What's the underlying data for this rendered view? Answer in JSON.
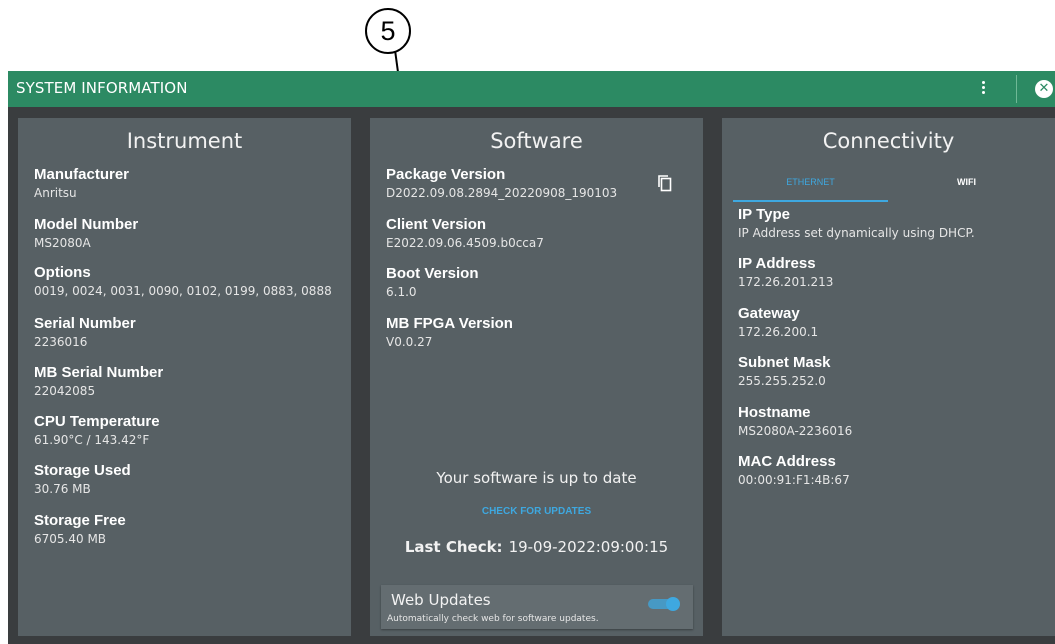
{
  "callout": {
    "number": "5"
  },
  "window": {
    "title": "SYSTEM INFORMATION",
    "menu_icon": "more-vertical-icon",
    "close_icon": "close-circle-icon",
    "close_glyph": "✕"
  },
  "colors": {
    "titlebar": "#2c8a63",
    "background": "#3a3d3f",
    "panel": "#576064",
    "accent": "#3ea8e0"
  },
  "instrument": {
    "title": "Instrument",
    "fields": [
      {
        "label": "Manufacturer",
        "value": "Anritsu"
      },
      {
        "label": "Model Number",
        "value": "MS2080A"
      },
      {
        "label": "Options",
        "value": "0019, 0024, 0031, 0090, 0102, 0199, 0883, 0888"
      },
      {
        "label": "Serial Number",
        "value": "2236016"
      },
      {
        "label": "MB Serial Number",
        "value": "22042085"
      },
      {
        "label": "CPU Temperature",
        "value": "61.90°C / 143.42°F"
      },
      {
        "label": "Storage Used",
        "value": "30.76 MB"
      },
      {
        "label": "Storage Free",
        "value": "6705.40 MB"
      }
    ]
  },
  "software": {
    "title": "Software",
    "copy_icon": "copy-icon",
    "fields": [
      {
        "label": "Package Version",
        "value": "D2022.09.08.2894_20220908_190103"
      },
      {
        "label": "Client Version",
        "value": "E2022.09.06.4509.b0cca7"
      },
      {
        "label": "Boot Version",
        "value": "6.1.0"
      },
      {
        "label": "MB FPGA Version",
        "value": "V0.0.27"
      }
    ],
    "status": "Your software is up to date",
    "check_button": "CHECK FOR UPDATES",
    "last_check_label": "Last Check:",
    "last_check_value": "19-09-2022:09:00:15",
    "web_updates": {
      "title": "Web Updates",
      "description": "Automatically check web for software updates.",
      "enabled": true
    }
  },
  "connectivity": {
    "title": "Connectivity",
    "tabs": [
      {
        "label": "ETHERNET",
        "active": true
      },
      {
        "label": "WIFI",
        "active": false
      }
    ],
    "fields": [
      {
        "label": "IP Type",
        "value": "IP Address set dynamically using DHCP."
      },
      {
        "label": "IP Address",
        "value": "172.26.201.213"
      },
      {
        "label": "Gateway",
        "value": "172.26.200.1"
      },
      {
        "label": "Subnet Mask",
        "value": "255.255.252.0"
      },
      {
        "label": "Hostname",
        "value": "MS2080A-2236016"
      },
      {
        "label": "MAC Address",
        "value": "00:00:91:F1:4B:67"
      }
    ]
  }
}
